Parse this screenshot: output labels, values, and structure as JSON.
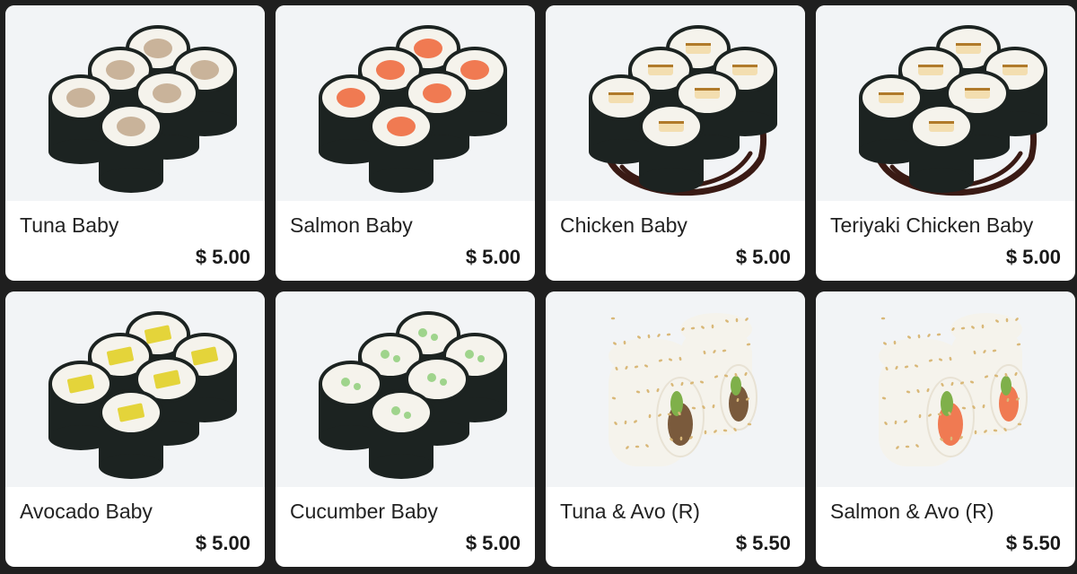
{
  "menu": {
    "items": [
      {
        "name": "Tuna Baby",
        "price": "$ 5.00",
        "roll_type": "maki",
        "filling": "tuna"
      },
      {
        "name": "Salmon Baby",
        "price": "$ 5.00",
        "roll_type": "maki",
        "filling": "salmon"
      },
      {
        "name": "Chicken Baby",
        "price": "$ 5.00",
        "roll_type": "maki",
        "filling": "chicken"
      },
      {
        "name": "Teriyaki Chicken Baby",
        "price": "$ 5.00",
        "roll_type": "maki",
        "filling": "teriyaki-chicken"
      },
      {
        "name": "Avocado Baby",
        "price": "$ 5.00",
        "roll_type": "maki",
        "filling": "avocado"
      },
      {
        "name": "Cucumber Baby",
        "price": "$ 5.00",
        "roll_type": "maki",
        "filling": "cucumber"
      },
      {
        "name": "Tuna & Avo (R)",
        "price": "$ 5.50",
        "roll_type": "uramaki",
        "filling": "tuna-avocado"
      },
      {
        "name": "Salmon & Avo (R)",
        "price": "$ 5.50",
        "roll_type": "uramaki",
        "filling": "salmon-avocado"
      }
    ]
  },
  "colors": {
    "page_background": "#1f1f1f",
    "card_background": "#ffffff",
    "photo_background": "#f2f4f6",
    "nori": "#1c2321",
    "rice": "#f5f3ec",
    "tuna": "#c9b39a",
    "salmon": "#f07a52",
    "chicken": "#f3deb0",
    "teriyaki_sauce": "#3a1a14",
    "avocado": "#e4d43a",
    "cucumber": "#9fd48c",
    "sesame": "#d9b878"
  }
}
